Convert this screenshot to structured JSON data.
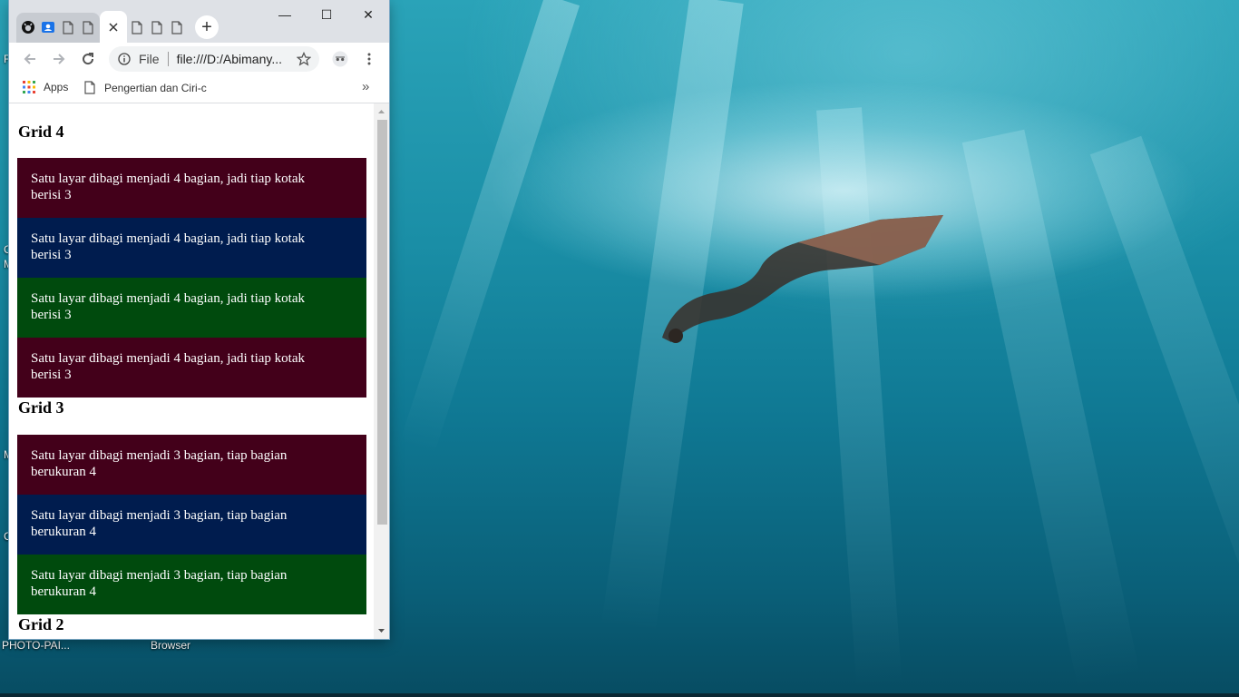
{
  "desktop": {
    "icons": [
      {
        "label": "PHOTO-PAI..."
      },
      {
        "label": "Browser"
      }
    ],
    "edge_letters": [
      "F",
      "C",
      "M",
      "M",
      "C"
    ]
  },
  "browser": {
    "title_controls": {
      "minimize": "—",
      "maximize": "☐",
      "close": "✕"
    },
    "tabs": [
      {
        "icon": "github-icon"
      },
      {
        "icon": "contacts-icon"
      },
      {
        "icon": "document-icon"
      },
      {
        "icon": "document-icon"
      },
      {
        "icon": "close-icon",
        "active": true
      },
      {
        "icon": "document-icon"
      },
      {
        "icon": "document-icon"
      },
      {
        "icon": "document-icon"
      }
    ],
    "new_tab_label": "+",
    "omnibox": {
      "scheme_label": "File",
      "url": "file:///D:/Abimany..."
    },
    "bookmarks": [
      {
        "icon": "apps-grid-icon",
        "label": "Apps"
      },
      {
        "icon": "document-icon",
        "label": "Pengertian dan Ciri-c"
      }
    ],
    "bookmarks_overflow": "»"
  },
  "page": {
    "sections": [
      {
        "title": "Grid 4",
        "boxes": [
          {
            "line1": "Satu layar dibagi menjadi 4 bagian, jadi tiap kotak",
            "line2": "berisi 3"
          },
          {
            "line1": "Satu layar dibagi menjadi 4 bagian, jadi tiap kotak",
            "line2": "berisi 3"
          },
          {
            "line1": "Satu layar dibagi menjadi 4 bagian, jadi tiap kotak",
            "line2": "berisi 3"
          },
          {
            "line1": "Satu layar dibagi menjadi 4 bagian, jadi tiap kotak",
            "line2": "berisi 3"
          }
        ]
      },
      {
        "title": "Grid 3",
        "boxes": [
          {
            "line1": "Satu layar dibagi menjadi 3 bagian, tiap bagian",
            "line2": "berukuran 4"
          },
          {
            "line1": "Satu layar dibagi menjadi 3 bagian, tiap bagian",
            "line2": "berukuran 4"
          },
          {
            "line1": "Satu layar dibagi menjadi 3 bagian, tiap bagian",
            "line2": "berukuran 4"
          }
        ]
      },
      {
        "title": "Grid 2",
        "boxes": []
      }
    ],
    "colors": {
      "maroon": "#43001a",
      "navy": "#001c4e",
      "green": "#004a0d"
    }
  }
}
